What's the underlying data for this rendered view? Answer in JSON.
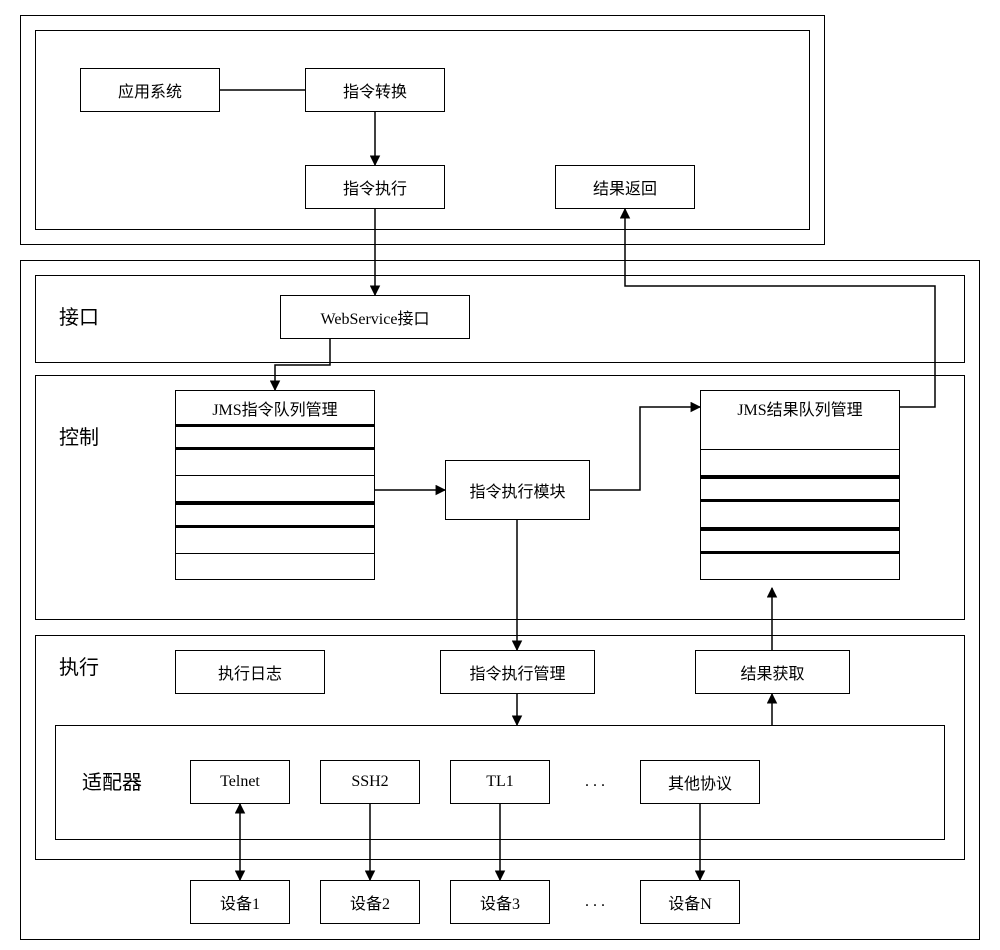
{
  "top": {
    "app_system": "应用系统",
    "cmd_convert": "指令转换",
    "cmd_exec": "指令执行",
    "result_return": "结果返回"
  },
  "interface": {
    "label": "接口",
    "webservice": "WebService接口"
  },
  "control": {
    "label": "控制",
    "jms_cmd_queue": "JMS指令队列管理",
    "exec_module": "指令执行模块",
    "jms_result_queue": "JMS结果队列管理"
  },
  "exec": {
    "label": "执行",
    "exec_log": "执行日志",
    "exec_mgmt": "指令执行管理",
    "result_fetch": "结果获取"
  },
  "adapter": {
    "label": "适配器",
    "telnet": "Telnet",
    "ssh2": "SSH2",
    "tl1": "TL1",
    "dots": ". . .",
    "other": "其他协议"
  },
  "devices": {
    "d1": "设备1",
    "d2": "设备2",
    "d3": "设备3",
    "dots": ". . .",
    "dn": "设备N"
  }
}
